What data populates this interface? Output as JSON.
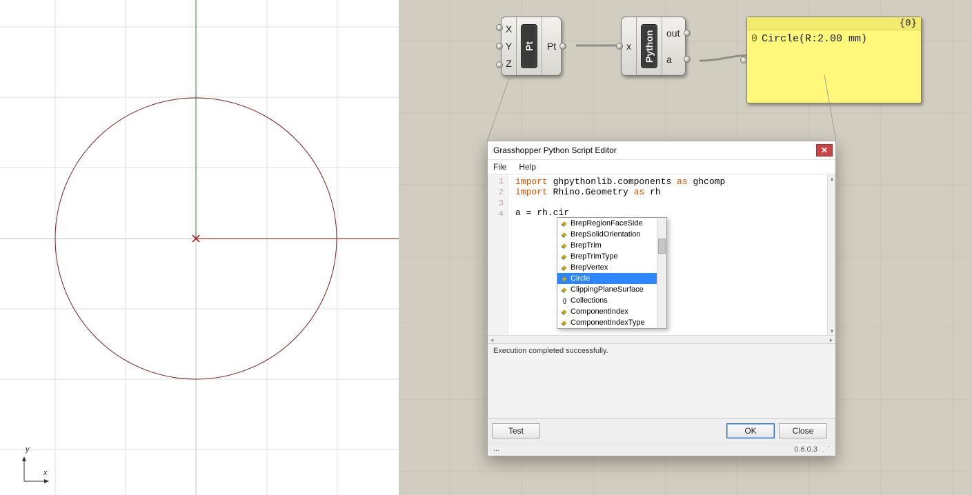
{
  "components": {
    "pt": {
      "label": "Pt",
      "inputs": [
        "X",
        "Y",
        "Z"
      ],
      "output": "Pt"
    },
    "python": {
      "label": "Python",
      "input": "x",
      "outputs": [
        "out",
        "a"
      ]
    }
  },
  "panel": {
    "header": "{0}",
    "index": "0",
    "text": "Circle(R:2.00 mm)"
  },
  "editor": {
    "title": "Grasshopper Python Script Editor",
    "menu": {
      "file": "File",
      "help": "Help"
    },
    "lines": [
      "1",
      "2",
      "3",
      "4"
    ],
    "code": {
      "l1a": "import",
      "l1b": " ghpythonlib.components ",
      "l1c": "as",
      "l1d": " ghcomp",
      "l2a": "import",
      "l2b": " Rhino.Geometry ",
      "l2c": "as",
      "l2d": " rh",
      "l4": "a = rh.cir"
    },
    "autocomplete": [
      {
        "kind": "cls2",
        "label": "BrepRegionFaceSide"
      },
      {
        "kind": "cls2",
        "label": "BrepSolidOrientation"
      },
      {
        "kind": "cls2",
        "label": "BrepTrim"
      },
      {
        "kind": "cls2",
        "label": "BrepTrimType"
      },
      {
        "kind": "cls2",
        "label": "BrepVertex"
      },
      {
        "kind": "cls2",
        "label": "Circle",
        "selected": true
      },
      {
        "kind": "cls2",
        "label": "ClippingPlaneSurface"
      },
      {
        "kind": "ns",
        "label": "Collections"
      },
      {
        "kind": "cls2",
        "label": "ComponentIndex"
      },
      {
        "kind": "cls2",
        "label": "ComponentIndexType"
      }
    ],
    "status": "Execution completed successfully.",
    "buttons": {
      "test": "Test",
      "ok": "OK",
      "close": "Close"
    },
    "strip_left": "...",
    "version": "0.6.0.3"
  },
  "axis": {
    "x": "x",
    "y": "y"
  }
}
